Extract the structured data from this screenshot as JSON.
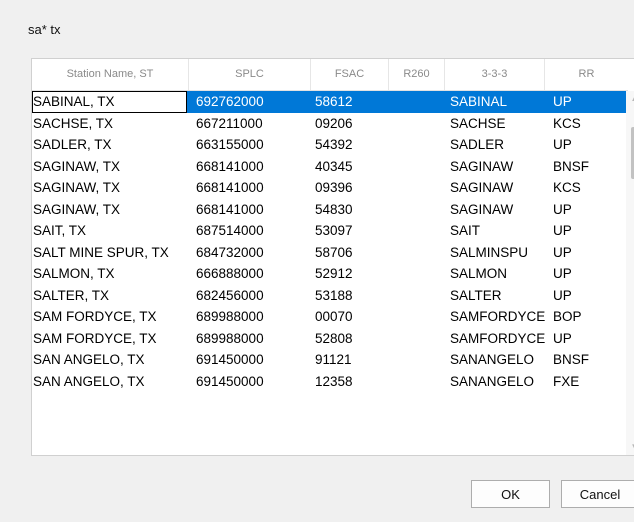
{
  "search": {
    "query": "sa* tx"
  },
  "grid": {
    "columns": [
      "Station Name, ST",
      "SPLC",
      "FSAC",
      "R260",
      "3-3-3",
      "RR"
    ],
    "selected_row": 0,
    "rows": [
      [
        "SABINAL, TX",
        "692762000",
        "58612",
        "",
        "SABINAL",
        "UP"
      ],
      [
        "SACHSE, TX",
        "667211000",
        "09206",
        "",
        "SACHSE",
        "KCS"
      ],
      [
        "SADLER, TX",
        "663155000",
        "54392",
        "",
        "SADLER",
        "UP"
      ],
      [
        "SAGINAW, TX",
        "668141000",
        "40345",
        "",
        "SAGINAW",
        "BNSF"
      ],
      [
        "SAGINAW, TX",
        "668141000",
        "09396",
        "",
        "SAGINAW",
        "KCS"
      ],
      [
        "SAGINAW, TX",
        "668141000",
        "54830",
        "",
        "SAGINAW",
        "UP"
      ],
      [
        "SAIT, TX",
        "687514000",
        "53097",
        "",
        "SAIT",
        "UP"
      ],
      [
        "SALT MINE SPUR, TX",
        "684732000",
        "58706",
        "",
        "SALMINSPU",
        "UP"
      ],
      [
        "SALMON, TX",
        "666888000",
        "52912",
        "",
        "SALMON",
        "UP"
      ],
      [
        "SALTER, TX",
        "682456000",
        "53188",
        "",
        "SALTER",
        "UP"
      ],
      [
        "SAM FORDYCE, TX",
        "689988000",
        "00070",
        "",
        "SAMFORDYCE",
        "BOP"
      ],
      [
        "SAM FORDYCE, TX",
        "689988000",
        "52808",
        "",
        "SAMFORDYCE",
        "UP"
      ],
      [
        "SAN ANGELO, TX",
        "691450000",
        "91121",
        "",
        "SANANGELO",
        "BNSF"
      ],
      [
        "SAN ANGELO, TX",
        "691450000",
        "12358",
        "",
        "SANANGELO",
        "FXE"
      ]
    ]
  },
  "scrollbar": {
    "up_glyph": "▲",
    "down_glyph": "▼"
  },
  "buttons": {
    "ok": "OK",
    "cancel": "Cancel"
  },
  "colors": {
    "selection": "#0078d7",
    "header_text": "#8a8a8a"
  }
}
